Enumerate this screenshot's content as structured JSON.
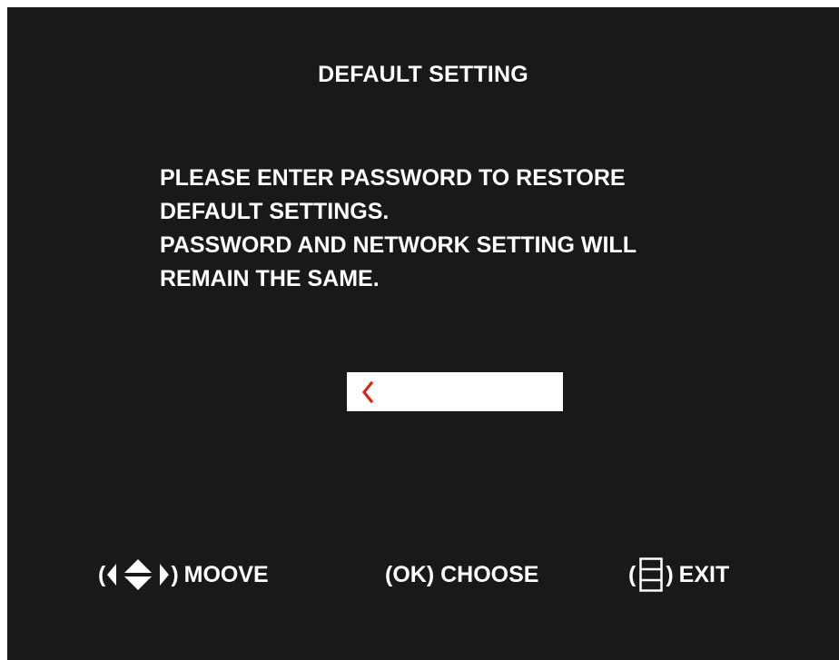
{
  "dialog": {
    "title": "DEFAULT SETTING",
    "message_lines": [
      "PLEASE ENTER PASSWORD TO RESTORE",
      "DEFAULT SETTINGS.",
      "PASSWORD AND NETWORK SETTING WILL",
      "REMAIN THE SAME."
    ]
  },
  "password": {
    "value": "",
    "cursor_icon": "chevron-left-icon"
  },
  "footer": {
    "open_paren": "(",
    "close_paren": ")",
    "move": {
      "icon": "direction-arrows-icon",
      "label": "MOOVE"
    },
    "choose": {
      "label": "(OK) CHOOSE"
    },
    "exit": {
      "icon": "menu-icon",
      "label": "EXIT"
    }
  },
  "colors": {
    "background": "#181918",
    "text": "#ffffff",
    "input_background": "#ffffff",
    "cursor": "#d9261c"
  }
}
